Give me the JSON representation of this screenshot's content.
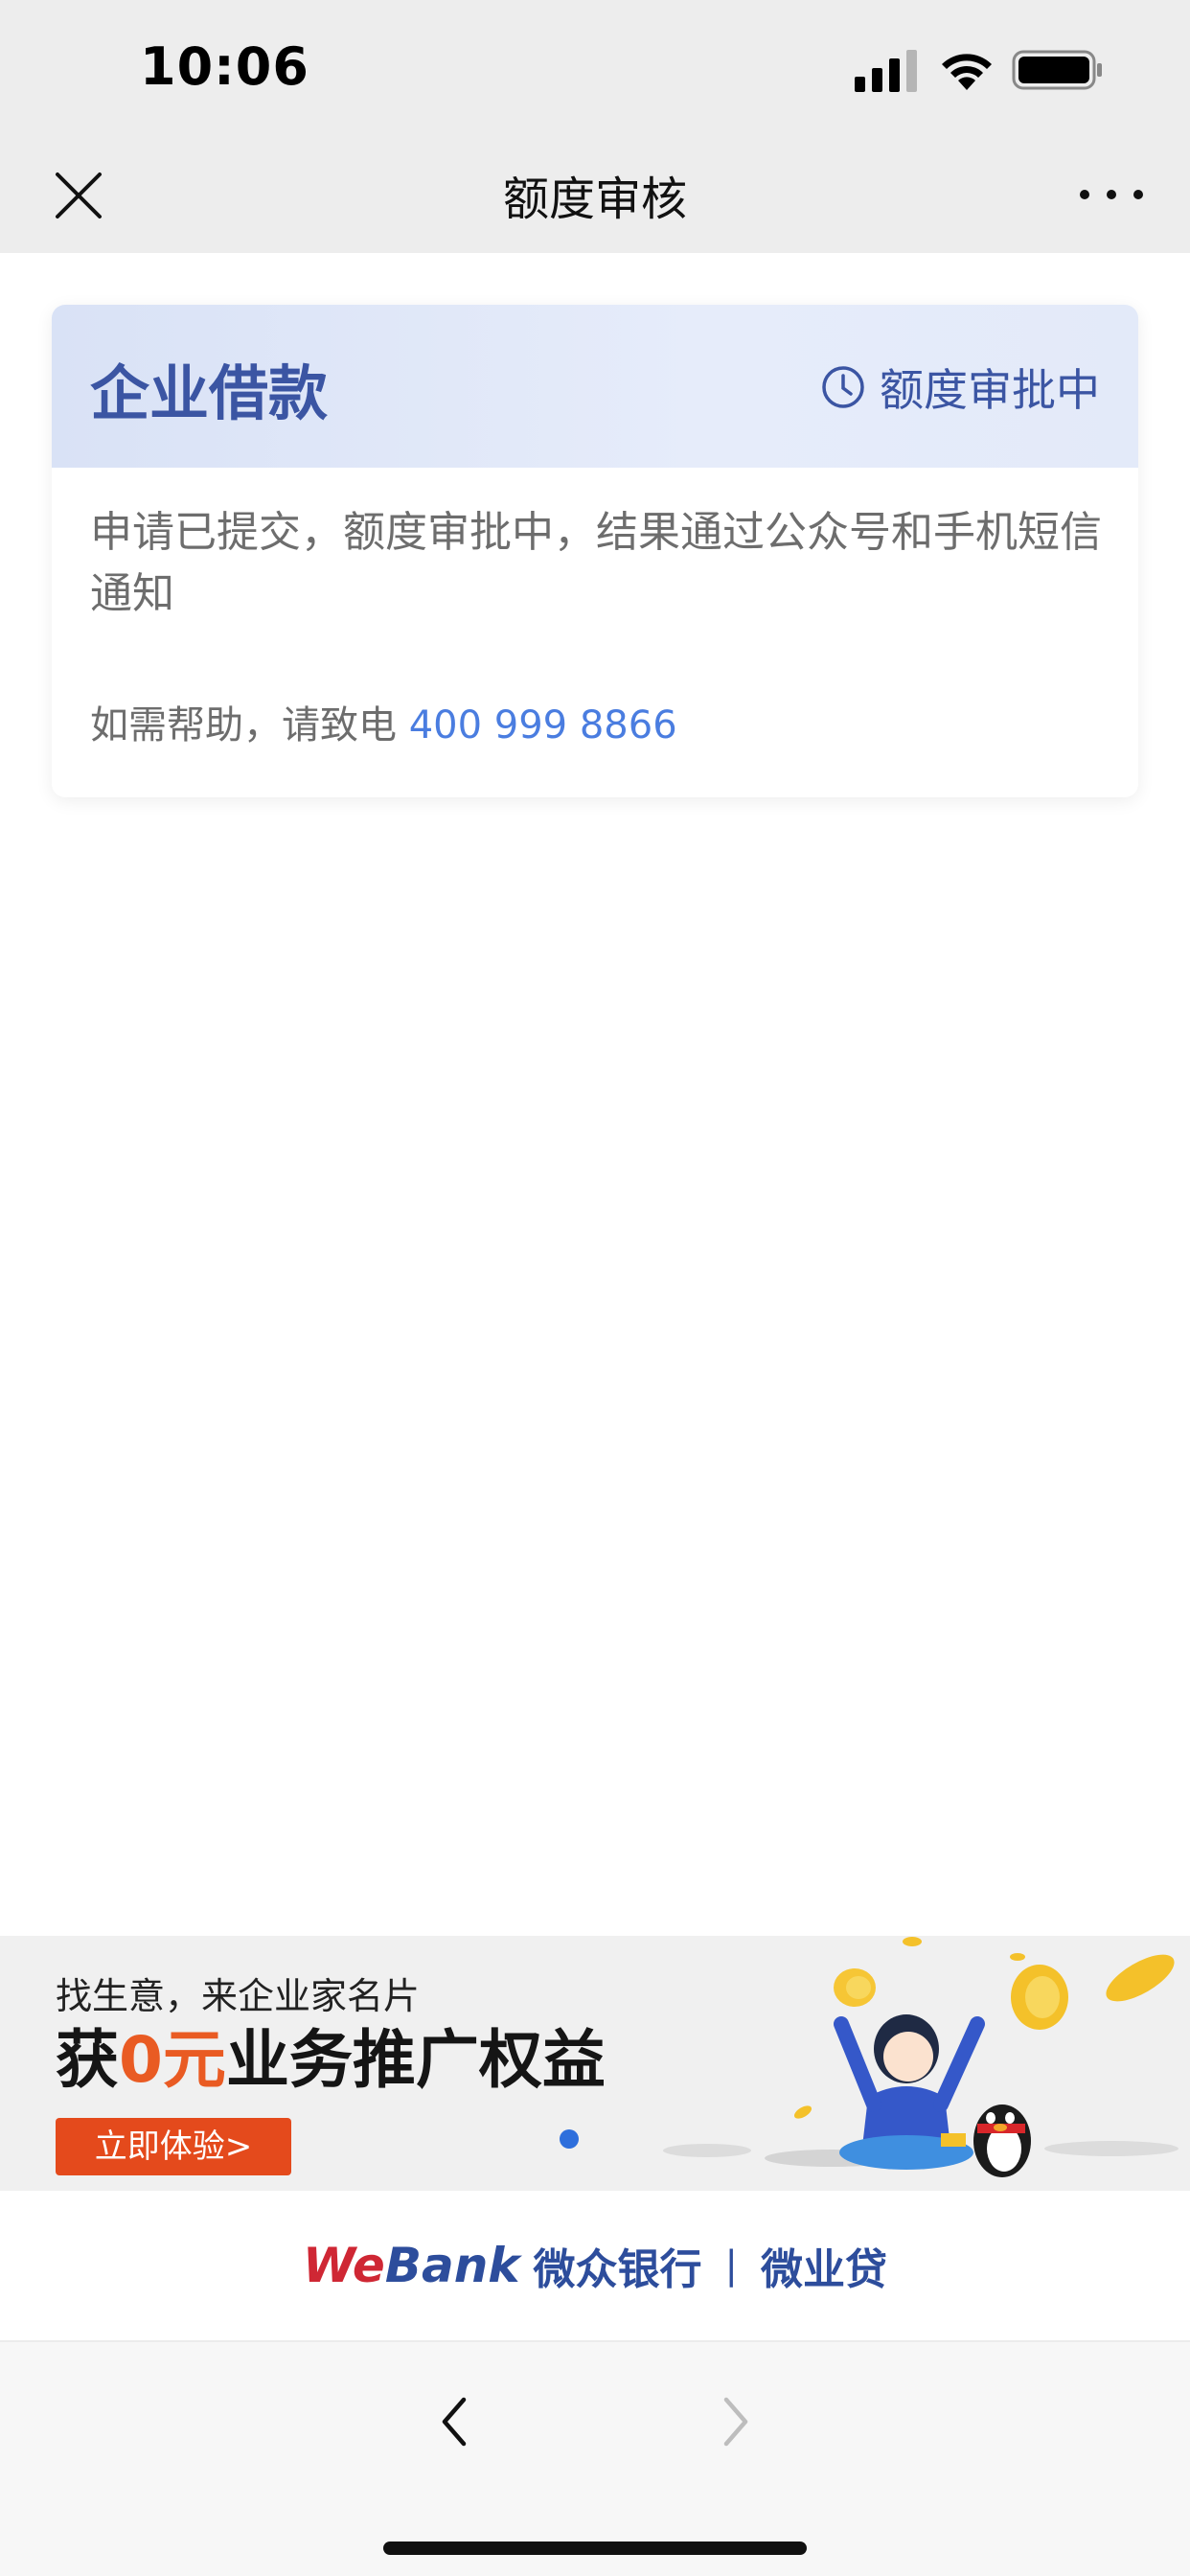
{
  "status_bar": {
    "time": "10:06"
  },
  "nav": {
    "title": "额度审核"
  },
  "card": {
    "title": "企业借款",
    "status": "额度审批中",
    "message": "申请已提交，额度审批中，结果通过公众号和手机短信通知",
    "help_prefix": "如需帮助，请致电 ",
    "phone": "400 999 8866"
  },
  "banner": {
    "subtitle": "找生意，来企业家名片",
    "headline_pre": "获",
    "headline_highlight": "0元",
    "headline_post": "业务推广权益",
    "button": "立即体验>"
  },
  "brand": {
    "en_we": "We",
    "en_bank": "Bank",
    "cn_name": "微众银行",
    "separator": "|",
    "product": "微业贷"
  },
  "colors": {
    "accent": "#3b55a3",
    "link": "#4a7de0",
    "promo": "#e44a1c"
  }
}
